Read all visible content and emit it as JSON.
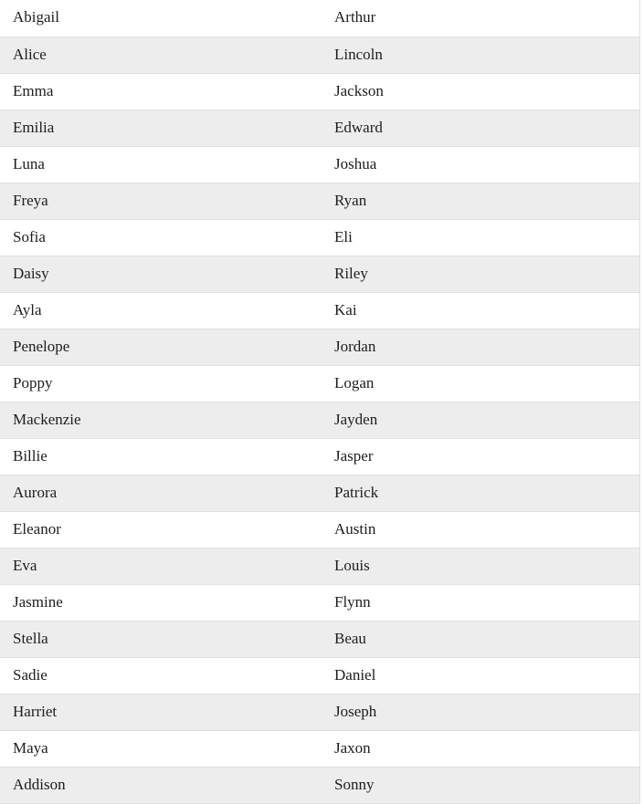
{
  "table": {
    "name": "names-table",
    "columns": [
      {
        "key": "first_name",
        "header": "",
        "name": "column-first-name"
      },
      {
        "key": "second_name",
        "header": "",
        "name": "column-second-name"
      }
    ],
    "row_count": 22,
    "striping": "even-rows-shaded",
    "colors": {
      "row_background": "#ffffff",
      "row_background_alt": "#ededed",
      "row_divider": "#e0e0e0",
      "text": "#1d1d1f"
    },
    "rows": [
      {
        "first_name": "Abigail",
        "second_name": "Arthur"
      },
      {
        "first_name": "Alice",
        "second_name": "Lincoln"
      },
      {
        "first_name": "Emma",
        "second_name": "Jackson"
      },
      {
        "first_name": "Emilia",
        "second_name": "Edward"
      },
      {
        "first_name": "Luna",
        "second_name": "Joshua"
      },
      {
        "first_name": "Freya",
        "second_name": "Ryan"
      },
      {
        "first_name": "Sofia",
        "second_name": "Eli"
      },
      {
        "first_name": "Daisy",
        "second_name": "Riley"
      },
      {
        "first_name": "Ayla",
        "second_name": "Kai"
      },
      {
        "first_name": "Penelope",
        "second_name": "Jordan"
      },
      {
        "first_name": "Poppy",
        "second_name": "Logan"
      },
      {
        "first_name": "Mackenzie",
        "second_name": "Jayden"
      },
      {
        "first_name": "Billie",
        "second_name": "Jasper"
      },
      {
        "first_name": "Aurora",
        "second_name": "Patrick"
      },
      {
        "first_name": "Eleanor",
        "second_name": "Austin"
      },
      {
        "first_name": "Eva",
        "second_name": "Louis"
      },
      {
        "first_name": "Jasmine",
        "second_name": "Flynn"
      },
      {
        "first_name": "Stella",
        "second_name": "Beau"
      },
      {
        "first_name": "Sadie",
        "second_name": "Daniel"
      },
      {
        "first_name": "Harriet",
        "second_name": "Joseph"
      },
      {
        "first_name": "Maya",
        "second_name": "Jaxon"
      },
      {
        "first_name": "Addison",
        "second_name": "Sonny"
      }
    ]
  }
}
